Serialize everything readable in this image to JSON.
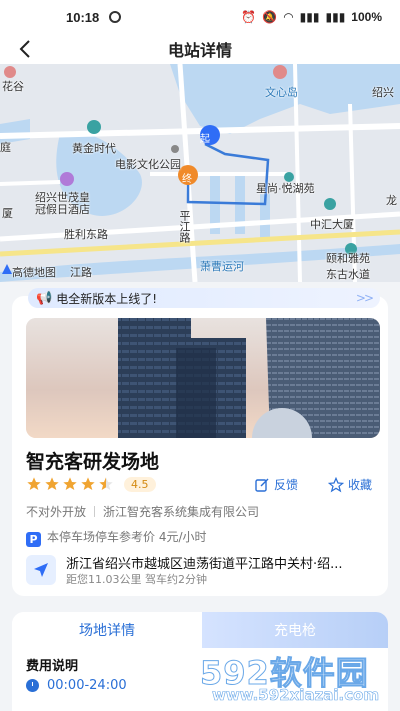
{
  "status_bar": {
    "time": "10:18",
    "signal1": "⁵ᴳ",
    "signal2": "⁵ᴳ",
    "battery": "100%"
  },
  "nav": {
    "title": "电站详情",
    "back_icon": "chevron-left-icon"
  },
  "map": {
    "labels": {
      "hua_gu": "花谷",
      "wen_xin_dao": "文心岛",
      "shao_xing": "绍兴",
      "huang_jin_shi_dai": "黄金时代",
      "dian_ying": "电影文化公园",
      "ting": "庭",
      "sha": "厦",
      "huang_guan": "绍兴世茂皇\n冠假日酒店",
      "sheng_li_dong_lu": "胜利东路",
      "ping_jiang_lu": "平江路",
      "xing_hang": "星尚·悦湖苑",
      "zhong_hui": "中汇大厦",
      "yi_he_ya_yuan": "颐和雅苑",
      "dong_gu_shui_dao": "东古水道",
      "xiao_cao_yun_he": "萧曹运河",
      "gao_de": "高德地图",
      "jiang_lu": "江路",
      "long": "龙",
      "sha2": "厦"
    },
    "markers": {
      "start": "起",
      "end": "终"
    }
  },
  "notice": {
    "text": "电全新版本上线了!",
    "arrows": ">>"
  },
  "station": {
    "name": "智充客研发场地",
    "rating": 4.5,
    "rating_label": "4.5",
    "feedback_label": "反馈",
    "favorite_label": "收藏",
    "access": "不对外开放",
    "operator": "浙江智充客系统集成有限公司",
    "parking_icon": "P",
    "parking": "本停车场停车参考价 4元/小时",
    "address": "浙江省绍兴市越城区迪荡街道平江路中关村·绍...",
    "distance": "距您11.03公里 驾车约2分钟"
  },
  "tabs": {
    "left": "场地详情",
    "right": "充电枪"
  },
  "fee": {
    "title": "费用说明",
    "hours": "00:00-24:00"
  },
  "watermark": {
    "brand": "592软件园",
    "url": "www.592xiazai.com"
  },
  "colors": {
    "accent": "#2f6df6",
    "rating": "#f0a431",
    "route": "#3a7bd8",
    "water": "#bcd8f2"
  }
}
